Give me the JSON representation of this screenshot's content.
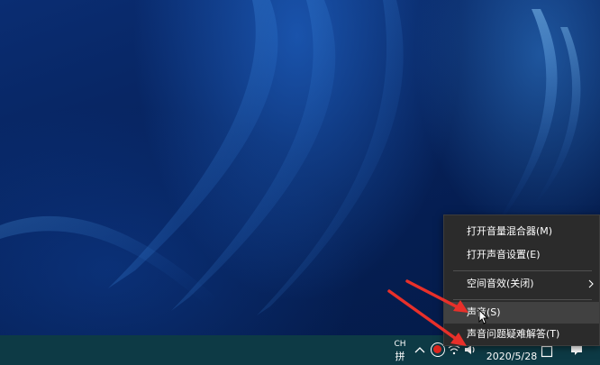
{
  "context_menu": {
    "items": [
      {
        "label": "打开音量混合器(M)"
      },
      {
        "label": "打开声音设置(E)"
      },
      {
        "label": "空间音效(关闭)",
        "has_submenu": true
      },
      {
        "label": "声音(S)",
        "highlighted": true
      },
      {
        "label": "声音问题疑难解答(T)"
      }
    ]
  },
  "taskbar": {
    "ime_top": "CH",
    "ime_bottom": "拼",
    "date": "2020/5/28",
    "icons": [
      "chevron-up-icon",
      "record-icon",
      "wifi-icon",
      "volume-icon",
      "show-desktop-icon",
      "notification-icon"
    ]
  },
  "annotation": {
    "arrow_color": "#e8302a"
  },
  "colors": {
    "menu_bg": "#2b2b2b",
    "menu_highlight": "#414141",
    "taskbar_bg": "#0d3a45"
  }
}
